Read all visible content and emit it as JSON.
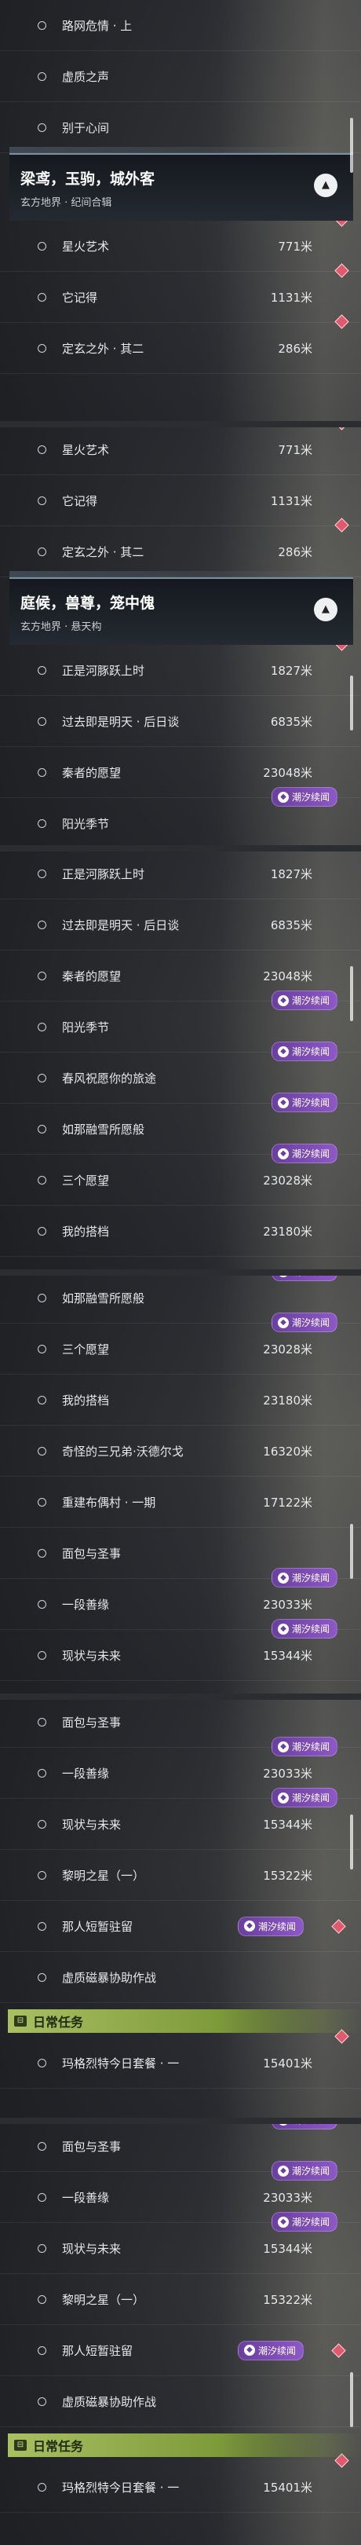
{
  "panels": [
    {
      "rows_before": [
        {
          "label": "路网危情 · 上"
        },
        {
          "label": "虚质之声"
        },
        {
          "label": "别于心间"
        }
      ],
      "header": {
        "title": "梁鸢，玉驹，城外客",
        "subtitle": "玄方地界 · 纪间合辑",
        "toggle": "▲"
      },
      "rows": [
        {
          "label": "星火艺术",
          "dist": "771米",
          "marker": true
        },
        {
          "label": "它记得",
          "dist": "1131米",
          "marker": true
        },
        {
          "label": "定玄之外 · 其二",
          "dist": "286米",
          "marker": true
        }
      ]
    },
    {
      "rows_before": [
        {
          "label": "星火艺术",
          "dist": "771米",
          "marker": true
        },
        {
          "label": "它记得",
          "dist": "1131米"
        },
        {
          "label": "定玄之外 · 其二",
          "dist": "286米",
          "marker": true
        }
      ],
      "header": {
        "title": "庭候，兽尊，笼中傀",
        "subtitle": "玄方地界 · 悬天构",
        "toggle": "▲"
      },
      "rows": [
        {
          "label": "正是河豚跃上时",
          "dist": "1827米",
          "marker": true
        },
        {
          "label": "过去即是明天 · 后日谈",
          "dist": "6835米"
        },
        {
          "label": "秦者的愿望",
          "dist": "23048米"
        },
        {
          "label": "阳光季节",
          "tag": "潮汐续闻"
        }
      ]
    },
    {
      "rows": [
        {
          "label": "正是河豚跃上时",
          "dist": "1827米"
        },
        {
          "label": "过去即是明天 · 后日谈",
          "dist": "6835米"
        },
        {
          "label": "秦者的愿望",
          "dist": "23048米"
        },
        {
          "label": "阳光季节",
          "tag": "潮汐续闻"
        },
        {
          "label": "春风祝愿你的旅途",
          "tag": "潮汐续闻"
        },
        {
          "label": "如那融雪所愿般",
          "tag": "潮汐续闻"
        },
        {
          "label": "三个愿望",
          "dist": "23028米",
          "tag": "潮汐续闻"
        },
        {
          "label": "我的搭档",
          "dist": "23180米"
        }
      ]
    },
    {
      "rows": [
        {
          "label": "如那融雪所愿般",
          "tag": "潮汐续闻"
        },
        {
          "label": "三个愿望",
          "dist": "23028米",
          "tag": "潮汐续闻"
        },
        {
          "label": "我的搭档",
          "dist": "23180米"
        },
        {
          "label": "奇怪的三兄弟·沃德尔戈",
          "dist": "16320米"
        },
        {
          "label": "重建布偶村 · 一期",
          "dist": "17122米"
        },
        {
          "label": "面包与圣事"
        },
        {
          "label": "一段善缘",
          "dist": "23033米",
          "tag": "潮汐续闻"
        },
        {
          "label": "现状与未来",
          "dist": "15344米",
          "tag": "潮汐续闻"
        }
      ]
    },
    {
      "rows": [
        {
          "label": "面包与圣事"
        },
        {
          "label": "一段善缘",
          "dist": "23033米",
          "tag": "潮汐续闻"
        },
        {
          "label": "现状与未来",
          "dist": "15344米",
          "tag": "潮汐续闻"
        },
        {
          "label": "黎明之星（一）",
          "dist": "15322米"
        },
        {
          "label": "那人短暂驻留",
          "tag_inline": "潮汐续闻",
          "marker_inline": true
        },
        {
          "label": "虚质磁暴协助作战"
        }
      ],
      "section": {
        "title": "日常任务"
      },
      "rows_after": [
        {
          "label": "玛格烈特今日套餐 · 一",
          "dist": "15401米",
          "marker": true
        }
      ]
    },
    {
      "rows": [
        {
          "label": "面包与圣事",
          "tag": "潮汐续闻"
        },
        {
          "label": "一段善缘",
          "dist": "23033米",
          "tag": "潮汐续闻"
        },
        {
          "label": "现状与未来",
          "dist": "15344米",
          "tag": "潮汐续闻"
        },
        {
          "label": "黎明之星（一）",
          "dist": "15322米"
        },
        {
          "label": "那人短暂驻留",
          "tag_inline": "潮汐续闻",
          "marker_inline": true
        },
        {
          "label": "虚质磁暴协助作战"
        }
      ],
      "section": {
        "title": "日常任务"
      },
      "rows_after": [
        {
          "label": "玛格烈特今日套餐 · 一",
          "dist": "15401米",
          "marker": true
        }
      ]
    }
  ]
}
